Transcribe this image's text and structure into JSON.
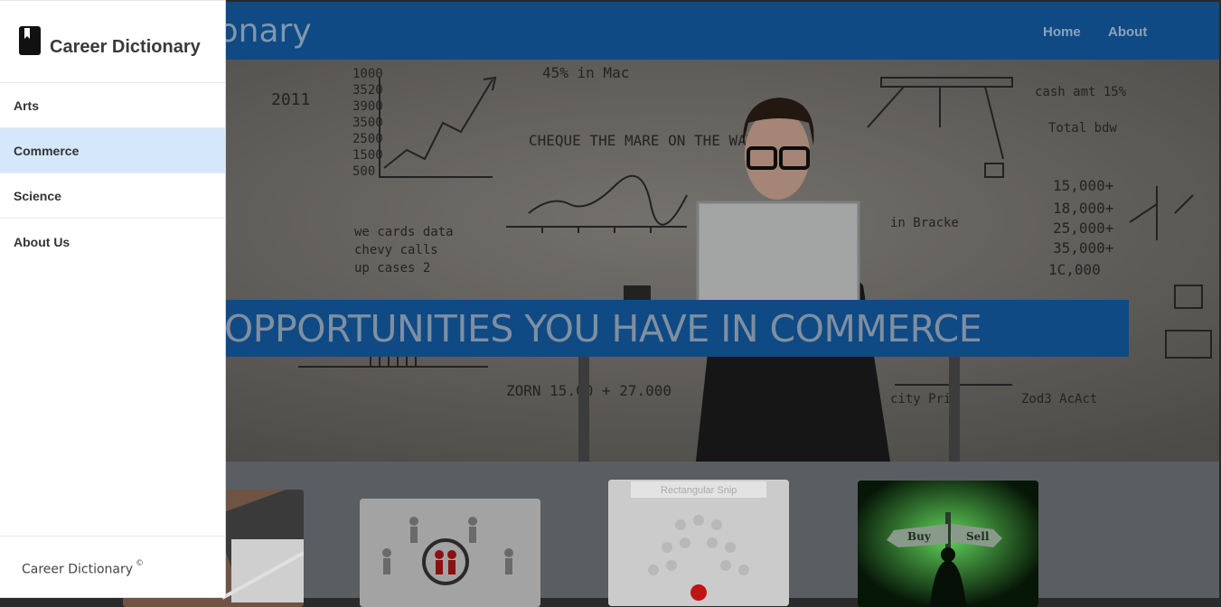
{
  "topbar": {
    "brand_fragment": "Dictionary",
    "nav": [
      {
        "label": "Home"
      },
      {
        "label": "About"
      }
    ]
  },
  "hero": {
    "banner_text": "OPPORTUNITIES YOU HAVE IN COMMERCE"
  },
  "cards": [
    {
      "name": "accounting-image"
    },
    {
      "name": "people-magnifier-image"
    },
    {
      "name": "crowd-leader-image",
      "overlay_text": "Rectangular Snip"
    },
    {
      "name": "buy-sell-signpost-image",
      "sign_left": "Buy",
      "sign_right": "Sell"
    }
  ],
  "sidebar": {
    "title": "Career Dictionary",
    "logo_icon": "book-icon",
    "items": [
      {
        "label": "Arts",
        "active": false
      },
      {
        "label": "Commerce",
        "active": true
      },
      {
        "label": "Science",
        "active": false
      },
      {
        "label": "About Us",
        "active": false
      }
    ],
    "footer": "Career Dictionary",
    "footer_mark": "©"
  },
  "colors": {
    "topbar": "#0f4a85",
    "sidebar_active": "#d5e8fb",
    "sidebar_bg": "#ffffff"
  }
}
